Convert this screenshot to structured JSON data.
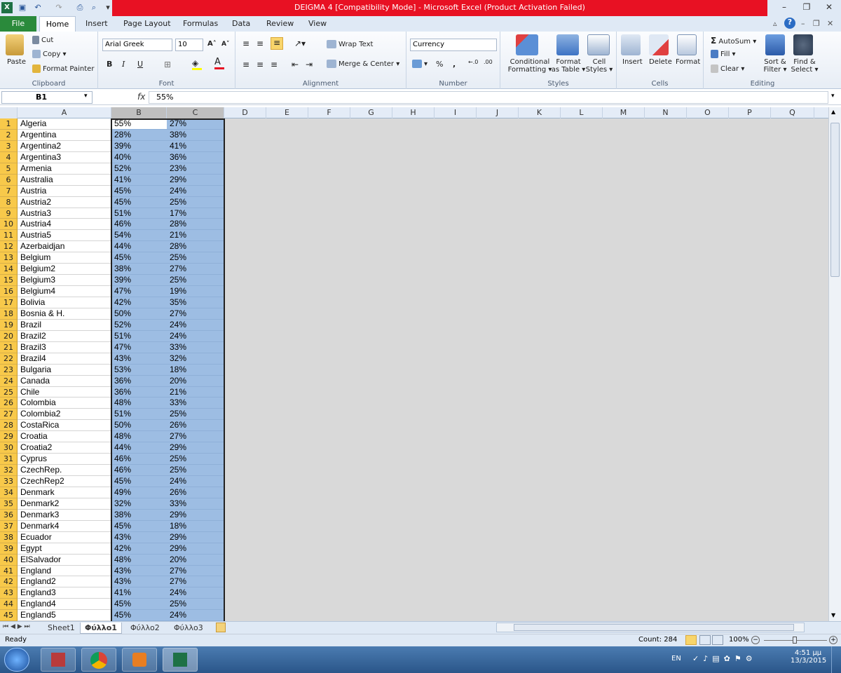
{
  "window": {
    "title": "DEIGMA 4  [Compatibility Mode]  -  Microsoft Excel (Product Activation Failed)"
  },
  "ribbon_tabs": [
    "File",
    "Home",
    "Insert",
    "Page Layout",
    "Formulas",
    "Data",
    "Review",
    "View"
  ],
  "clipboard": {
    "paste": "Paste",
    "cut": "Cut",
    "copy": "Copy ▾",
    "format_painter": "Format Painter",
    "label": "Clipboard"
  },
  "font": {
    "name": "Arial Greek",
    "size": "10",
    "label": "Font",
    "bold": "B",
    "italic": "I",
    "underline": "U"
  },
  "alignment": {
    "wrap": "Wrap Text",
    "merge": "Merge & Center ▾",
    "label": "Alignment"
  },
  "number": {
    "format": "Currency",
    "label": "Number",
    "percent": "%",
    "comma": ","
  },
  "styles": {
    "conditional": "Conditional",
    "conditional2": "Formatting ▾",
    "format_table": "Format",
    "format_table2": "as Table ▾",
    "cell_styles": "Cell",
    "cell_styles2": "Styles ▾",
    "label": "Styles"
  },
  "cells": {
    "insert": "Insert",
    "delete": "Delete",
    "format": "Format",
    "label": "Cells"
  },
  "editing": {
    "autosum": "AutoSum ▾",
    "fill": "Fill ▾",
    "clear": "Clear ▾",
    "sort": "Sort &",
    "sort2": "Filter ▾",
    "find": "Find &",
    "find2": "Select ▾",
    "label": "Editing"
  },
  "formula_bar": {
    "name_box": "B1",
    "fx": "fx",
    "content": "55%"
  },
  "columns": [
    "A",
    "B",
    "C",
    "D",
    "E",
    "F",
    "G",
    "H",
    "I",
    "J",
    "K",
    "L",
    "M",
    "N",
    "O",
    "P",
    "Q"
  ],
  "rows": [
    [
      "Algeria",
      "55%",
      "27%"
    ],
    [
      "Argentina",
      "28%",
      "38%"
    ],
    [
      "Argentina2",
      "39%",
      "41%"
    ],
    [
      "Argentina3",
      "40%",
      "36%"
    ],
    [
      "Armenia",
      "52%",
      "23%"
    ],
    [
      "Australia",
      "41%",
      "29%"
    ],
    [
      "Austria",
      "45%",
      "24%"
    ],
    [
      "Austria2",
      "45%",
      "25%"
    ],
    [
      "Austria3",
      "51%",
      "17%"
    ],
    [
      "Austria4",
      "46%",
      "28%"
    ],
    [
      "Austria5",
      "54%",
      "21%"
    ],
    [
      "Azerbaidjan",
      "44%",
      "28%"
    ],
    [
      "Belgium",
      "45%",
      "25%"
    ],
    [
      "Belgium2",
      "38%",
      "27%"
    ],
    [
      "Belgium3",
      "39%",
      "25%"
    ],
    [
      "Belgium4",
      "47%",
      "19%"
    ],
    [
      "Bolivia",
      "42%",
      "35%"
    ],
    [
      "Bosnia & H.",
      "50%",
      "27%"
    ],
    [
      "Brazil",
      "52%",
      "24%"
    ],
    [
      "Brazil2",
      "51%",
      "24%"
    ],
    [
      "Brazil3",
      "47%",
      "33%"
    ],
    [
      "Brazil4",
      "43%",
      "32%"
    ],
    [
      "Bulgaria",
      "53%",
      "18%"
    ],
    [
      "Canada",
      "36%",
      "20%"
    ],
    [
      "Chile",
      "36%",
      "21%"
    ],
    [
      "Colombia",
      "48%",
      "33%"
    ],
    [
      "Colombia2",
      "51%",
      "25%"
    ],
    [
      "CostaRica",
      "50%",
      "26%"
    ],
    [
      "Croatia",
      "48%",
      "27%"
    ],
    [
      "Croatia2",
      "44%",
      "29%"
    ],
    [
      "Cyprus",
      "46%",
      "25%"
    ],
    [
      "CzechRep.",
      "46%",
      "25%"
    ],
    [
      "CzechRep2",
      "45%",
      "24%"
    ],
    [
      "Denmark",
      "49%",
      "26%"
    ],
    [
      "Denmark2",
      "32%",
      "33%"
    ],
    [
      "Denmark3",
      "38%",
      "29%"
    ],
    [
      "Denmark4",
      "45%",
      "18%"
    ],
    [
      "Ecuador",
      "43%",
      "29%"
    ],
    [
      "Egypt",
      "42%",
      "29%"
    ],
    [
      "ElSalvador",
      "48%",
      "20%"
    ],
    [
      "England",
      "43%",
      "27%"
    ],
    [
      "England2",
      "43%",
      "27%"
    ],
    [
      "England3",
      "41%",
      "24%"
    ],
    [
      "England4",
      "45%",
      "25%"
    ],
    [
      "England5",
      "45%",
      "24%"
    ]
  ],
  "sheets": [
    "Sheet1",
    "Φύλλο1",
    "Φύλλο2",
    "Φύλλο3"
  ],
  "status": {
    "ready": "Ready",
    "count": "Count: 284",
    "zoom": "100%"
  },
  "taskbar": {
    "lang": "EN",
    "time": "4:51 μμ",
    "date": "13/3/2015"
  }
}
